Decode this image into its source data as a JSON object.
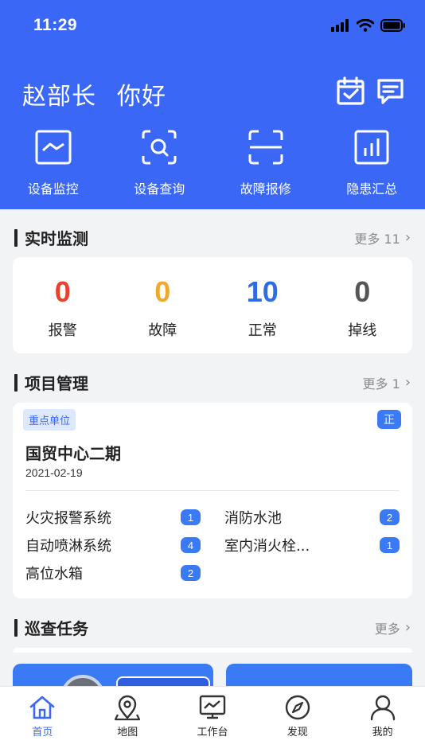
{
  "status_bar": {
    "time": "11:29"
  },
  "header": {
    "greeting_name": "赵部长",
    "greeting_text": "你好",
    "quick_actions": [
      {
        "label": "设备监控",
        "icon": "monitor-chart-icon"
      },
      {
        "label": "设备查询",
        "icon": "scan-search-icon"
      },
      {
        "label": "故障报修",
        "icon": "scan-frame-icon"
      },
      {
        "label": "隐患汇总",
        "icon": "bar-chart-icon"
      }
    ]
  },
  "realtime": {
    "title": "实时监测",
    "more": "更多 11",
    "items": [
      {
        "value": "0",
        "label": "报警",
        "color": "#e8412e"
      },
      {
        "value": "0",
        "label": "故障",
        "color": "#f0a92e"
      },
      {
        "value": "10",
        "label": "正常",
        "color": "#2f6ce0"
      },
      {
        "value": "0",
        "label": "掉线",
        "color": "#555555"
      }
    ]
  },
  "project": {
    "title": "项目管理",
    "more": "更多 1",
    "tag": "重点单位",
    "badge": "正",
    "name": "国贸中心二期",
    "date": "2021-02-19",
    "systems": [
      {
        "name": "火灾报警系统",
        "count": "1"
      },
      {
        "name": "消防水池",
        "count": "2"
      },
      {
        "name": "自动喷淋系统",
        "count": "4"
      },
      {
        "name": "室内消火栓...",
        "count": "1"
      },
      {
        "name": "高位水箱",
        "count": "2"
      }
    ]
  },
  "patrol": {
    "title": "巡查任务",
    "more": "更多"
  },
  "tabbar": [
    {
      "label": "首页",
      "icon": "home-icon",
      "active": true
    },
    {
      "label": "地图",
      "icon": "map-pin-icon",
      "active": false
    },
    {
      "label": "工作台",
      "icon": "workbench-icon",
      "active": false
    },
    {
      "label": "发现",
      "icon": "compass-icon",
      "active": false
    },
    {
      "label": "我的",
      "icon": "user-icon",
      "active": false
    }
  ],
  "colors": {
    "brand": "#3a67f5",
    "badge": "#3a7af5"
  }
}
